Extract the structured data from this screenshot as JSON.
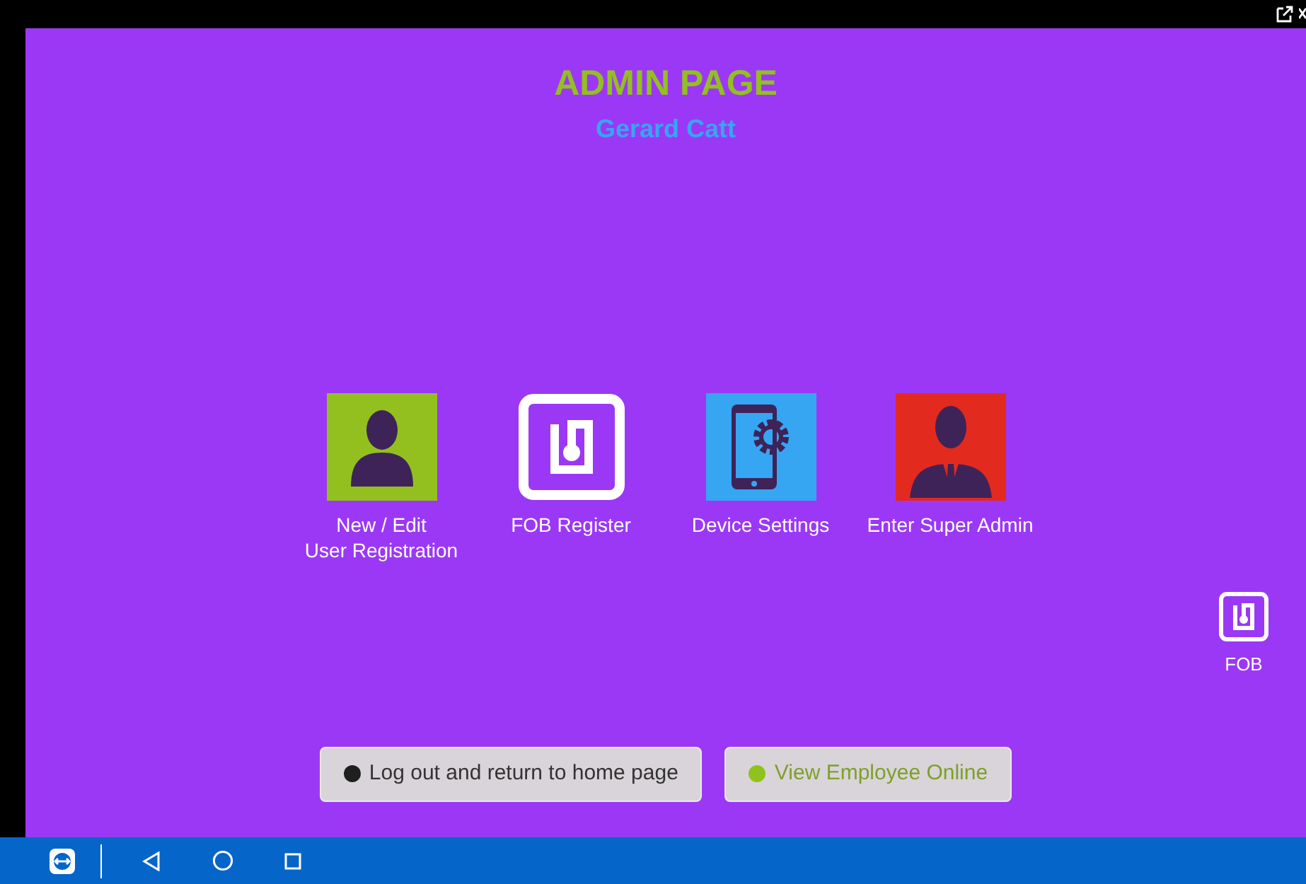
{
  "screen": {
    "title": "ADMIN PAGE",
    "user_name": "Gerard Catt"
  },
  "tiles": [
    {
      "kind": "user",
      "label": "New / Edit\nUser Registration",
      "color": "#93c01f"
    },
    {
      "kind": "fob",
      "label": "FOB Register",
      "color": "#ffffff"
    },
    {
      "kind": "device",
      "label": "Device Settings",
      "color": "#36a6f2"
    },
    {
      "kind": "admin",
      "label": "Enter Super Admin",
      "color": "#e32a1f"
    }
  ],
  "fob_shortcut": {
    "label": "FOB"
  },
  "buttons": [
    {
      "label": "Log out and return to home page",
      "color": "#1f1f1f"
    },
    {
      "label": "View Employee Online",
      "color": "#8fc21d"
    }
  ]
}
